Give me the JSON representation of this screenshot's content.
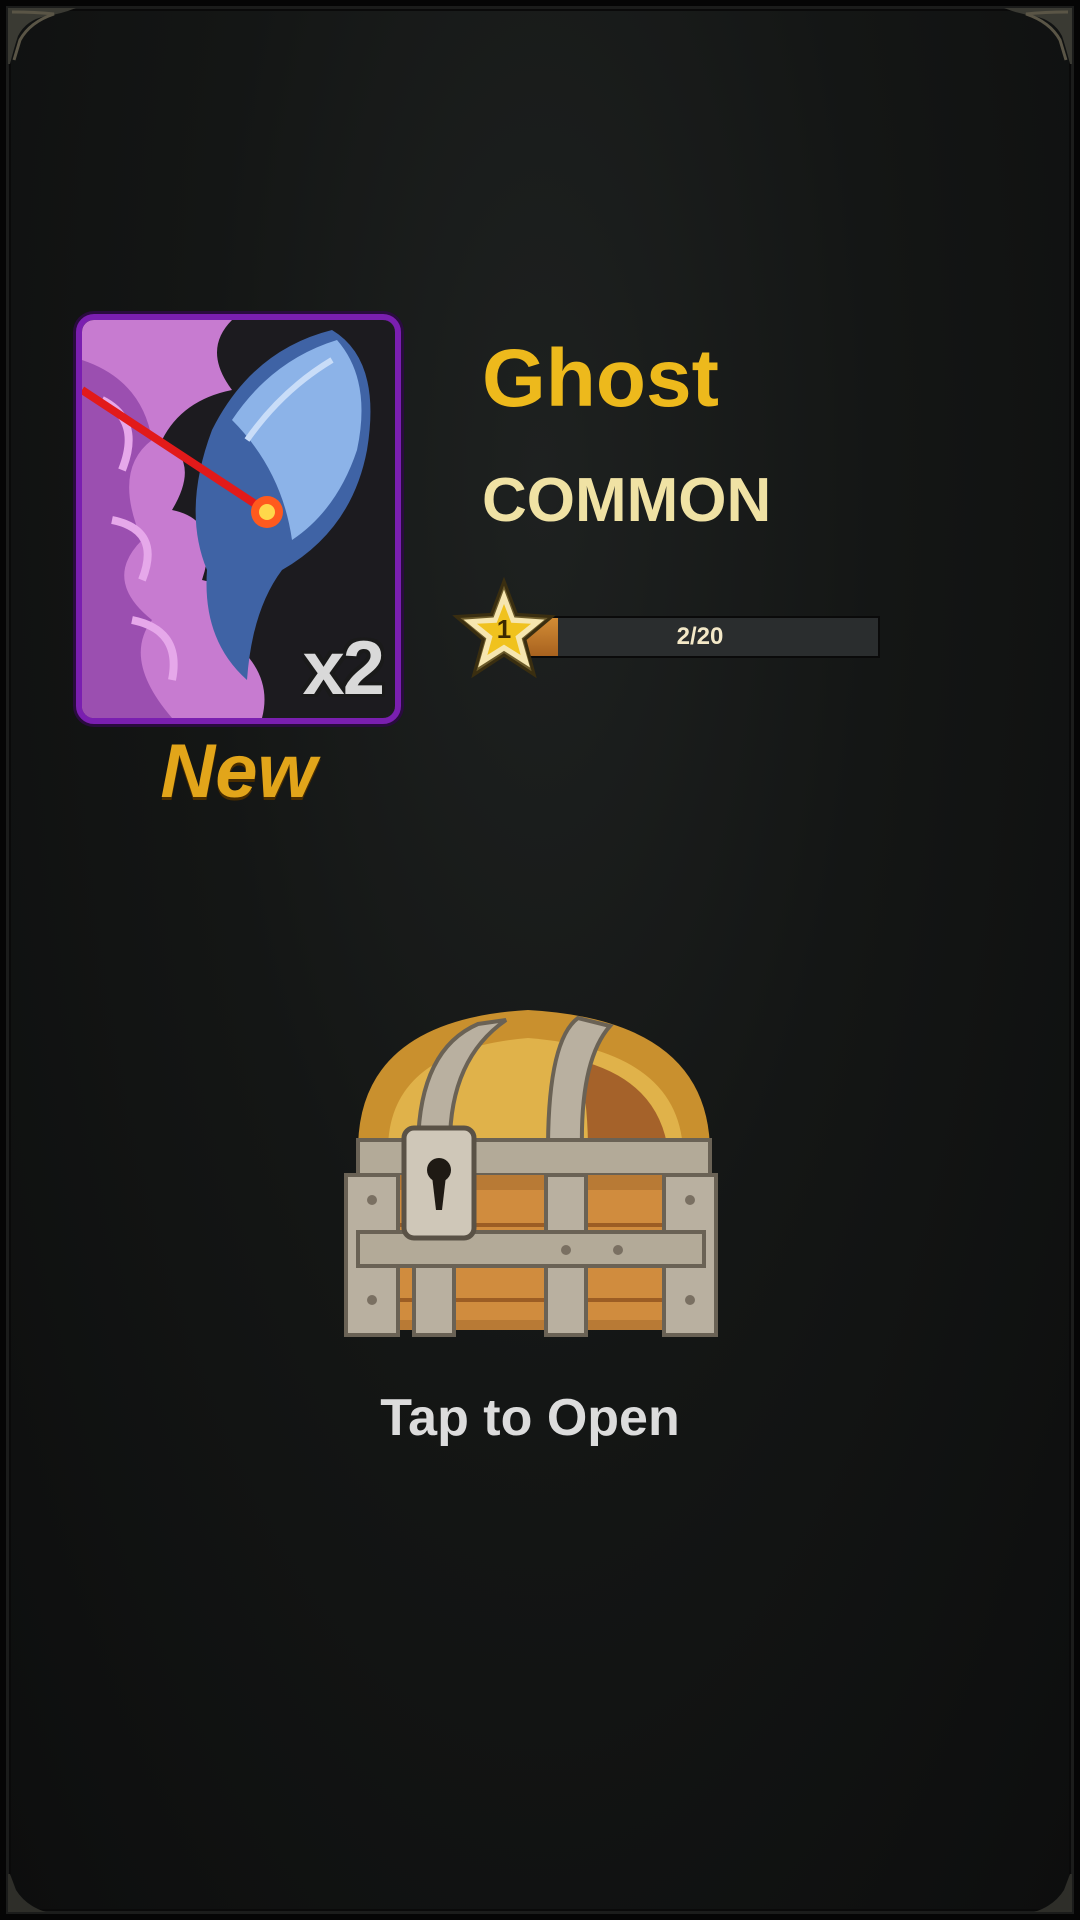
{
  "hero": {
    "name": "Ghost",
    "rarity": "COMMON",
    "count": "x2",
    "new_label": "New",
    "portrait_icon": "ghost-hero-portrait",
    "frame_color": "#7a1fb0"
  },
  "progress": {
    "star_level": "1",
    "text": "2/20",
    "fraction": 0.1
  },
  "chest": {
    "icon": "treasure-chest-icon",
    "action_label": "Tap to Open"
  },
  "colors": {
    "name": "#edb91c",
    "rarity": "#f0e2a4",
    "new_label": "#e2a51a",
    "background": "#141615"
  }
}
